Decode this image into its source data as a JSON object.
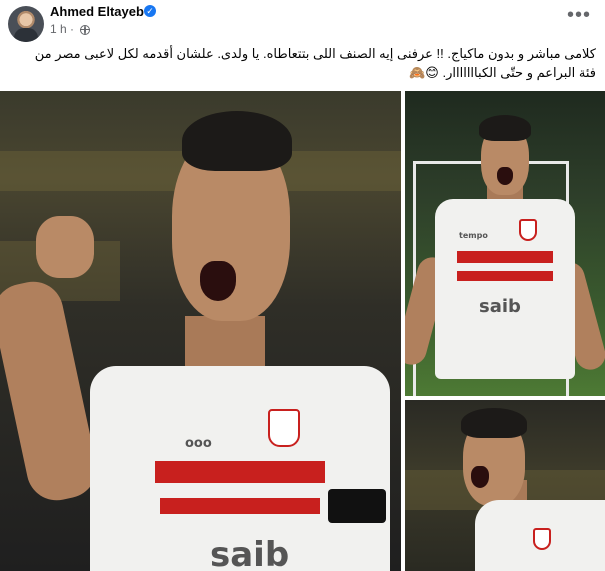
{
  "header": {
    "author_name": "Ahmed Eltayeb",
    "verified_symbol": "✓",
    "time_label": "1 h ·",
    "more_symbol": "•••"
  },
  "post": {
    "caption": "كلامى مباشر و بدون ماكياج. !! عرفنى إيه الصنف اللى بتتعاطاه. يا ولدى. علشان أقدمه لكل لاعبى مصر من فئة البراعم و حتّى الكبااااااار. 😊🙈"
  },
  "images": [
    {
      "sponsor": "saib",
      "brand": "ooo"
    },
    {
      "sponsor": "saib",
      "brand": "tempo"
    },
    {
      "sponsor": ""
    }
  ],
  "colors": {
    "accent": "#1877f2",
    "jersey_red": "#c8201e",
    "text": "#050505",
    "secondary_text": "#65676b"
  },
  "icons": [
    "avatar-icon",
    "verified-icon",
    "globe-icon",
    "more-icon"
  ]
}
